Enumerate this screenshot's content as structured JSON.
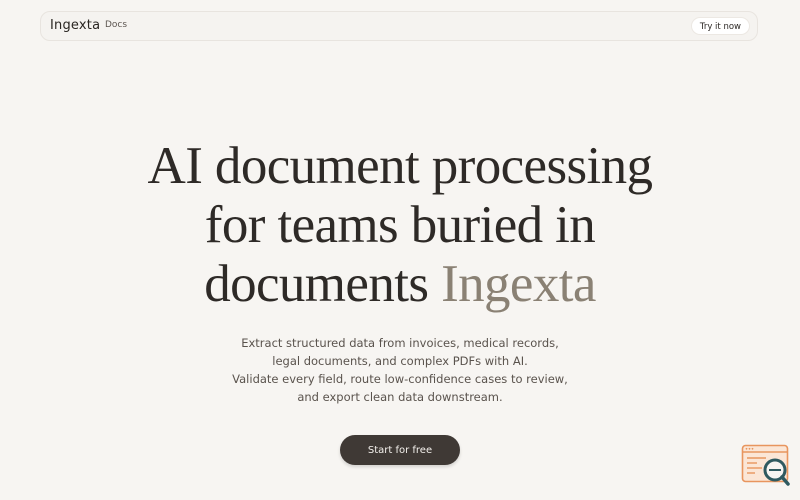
{
  "header": {
    "brand": "Ingexta",
    "nav_docs": "Docs",
    "cta_label": "Try it now"
  },
  "hero": {
    "title_lines": [
      "AI document processing",
      "for teams buried in"
    ],
    "title_line3_prefix": "documents",
    "title_accent": "Ingexta",
    "subtitle_lines": [
      "Extract structured data from invoices, medical records,",
      "legal documents, and complex PDFs with AI.",
      "Validate every field, route low-confidence cases to review,",
      "and export clean data downstream."
    ],
    "cta_label": "Start for free"
  },
  "widget": {
    "icon": "document-search-icon"
  },
  "colors": {
    "background": "#f7f5f2",
    "text": "#2e2a27",
    "accent": "#8a8174",
    "cta_bg": "#3f3935",
    "widget_orange": "#e8955e",
    "widget_teal": "#2f5a60"
  }
}
